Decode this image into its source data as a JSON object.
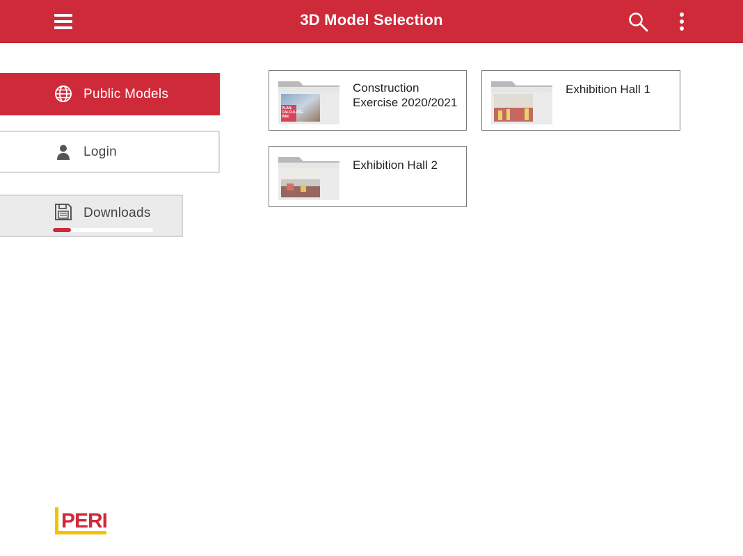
{
  "header": {
    "title": "3D Model Selection",
    "menu_icon": "hamburger-menu-icon",
    "search_icon": "search-icon",
    "more_icon": "more-vert-icon"
  },
  "sidebar": {
    "items": [
      {
        "label": "Public Models",
        "icon": "globe-icon",
        "selected": true
      },
      {
        "label": "Login",
        "icon": "person-icon",
        "selected": false
      },
      {
        "label": "Downloads",
        "icon": "floppy-disk-icon",
        "selected": false,
        "progress_fraction": 0.18
      }
    ]
  },
  "models": [
    {
      "name": "Construction\nExercise 2020/2021",
      "thumb_text": "PLAN.\nCALCULATE.\nWIN."
    },
    {
      "name": "Exhibition Hall 1"
    },
    {
      "name": "Exhibition Hall 2"
    }
  ],
  "brand": {
    "logo_text": "PERI"
  },
  "colors": {
    "accent": "#cf2a3a",
    "logo_yellow": "#f2c200"
  }
}
